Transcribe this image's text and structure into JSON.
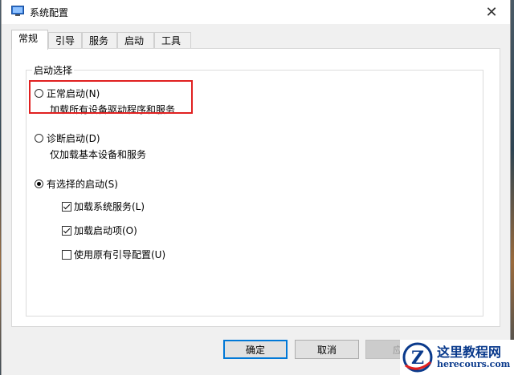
{
  "window": {
    "title": "系统配置"
  },
  "tabs": [
    {
      "label": "常规"
    },
    {
      "label": "引导"
    },
    {
      "label": "服务"
    },
    {
      "label": "启动"
    },
    {
      "label": "工具"
    }
  ],
  "startup_group": {
    "legend": "启动选择",
    "options": [
      {
        "label": "正常启动(N)",
        "description": "加载所有设备驱动程序和服务",
        "selected": false
      },
      {
        "label": "诊断启动(D)",
        "description": "仅加载基本设备和服务",
        "selected": false
      },
      {
        "label": "有选择的启动(S)",
        "selected": true
      }
    ],
    "checkboxes": [
      {
        "label": "加载系统服务(L)",
        "checked": true
      },
      {
        "label": "加载启动项(O)",
        "checked": true
      },
      {
        "label": "使用原有引导配置(U)",
        "checked": false
      }
    ]
  },
  "buttons": {
    "ok": "确定",
    "cancel": "取消",
    "apply": "应"
  },
  "watermark": {
    "title": "这里教程网",
    "url": "herecours.com",
    "logo_letter": "Z"
  },
  "colors": {
    "highlight": "#e02020",
    "primary_border": "#0078d7",
    "watermark_blue": "#0a3a8c"
  }
}
